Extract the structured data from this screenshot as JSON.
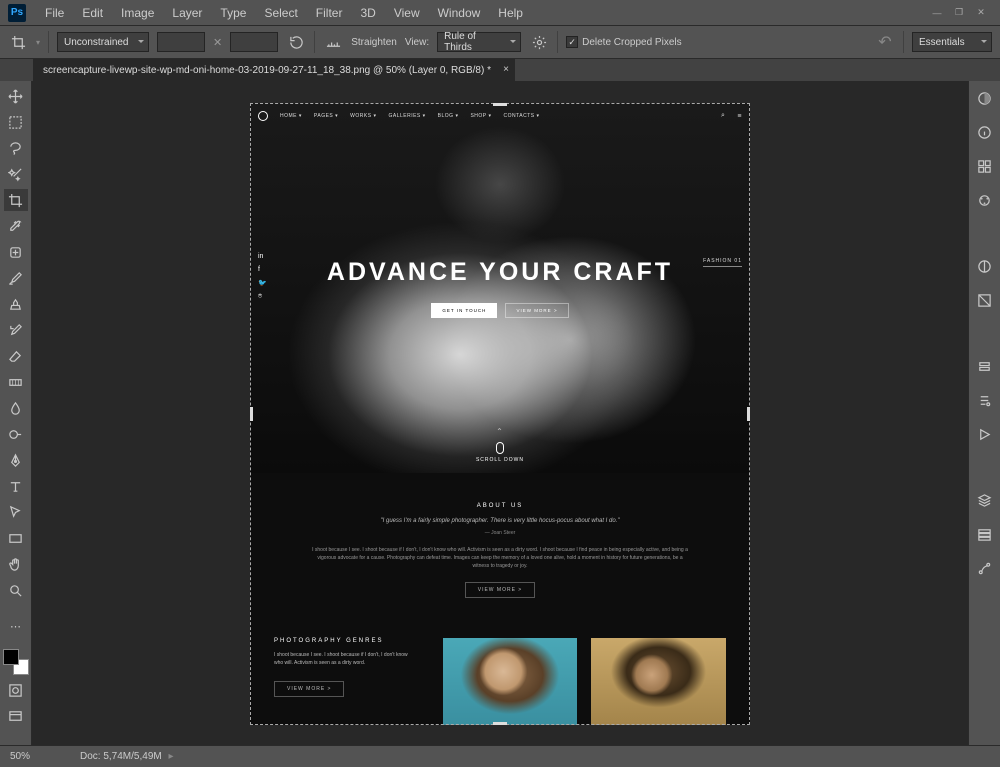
{
  "menubar": {
    "items": [
      "File",
      "Edit",
      "Image",
      "Layer",
      "Type",
      "Select",
      "Filter",
      "3D",
      "View",
      "Window",
      "Help"
    ]
  },
  "options": {
    "ratio": "Unconstrained",
    "width": "",
    "height": "",
    "straighten": "Straighten",
    "view_label": "View:",
    "view_value": "Rule of Thirds",
    "delete_cropped": "Delete Cropped Pixels",
    "workspace": "Essentials"
  },
  "tab": {
    "title": "screencapture-livewp-site-wp-md-oni-home-03-2019-09-27-11_18_38.png @ 50% (Layer 0, RGB/8) *"
  },
  "site": {
    "nav": [
      "HOME ▾",
      "PAGES ▾",
      "WORKS ▾",
      "GALLERIES ▾",
      "BLOG ▾",
      "SHOP ▾",
      "CONTACTS ▾"
    ],
    "hero_title": "ADVANCE YOUR CRAFT",
    "btn1": "GET IN TOUCH",
    "btn2": "VIEW MORE >",
    "meta": "FASHION   01",
    "scroll": "SCROLL DOWN",
    "about_h": "ABOUT US",
    "about_q": "\"I guess I'm a fairly simple photographer. There is very little hocus-pocus about what I do.\"",
    "about_a": "— Joan Steer",
    "about_p": "I shoot because I see. I shoot because if I don't, I don't know who will. Activism is seen as a dirty word. I shoot because I find peace in being especially active, and being a vigorous advocate for a cause. Photography can defeat time. Images can keep the memory of a loved one alive, hold a moment in history for future generations, be a witness to tragedy or joy.",
    "about_btn": "VIEW MORE  >",
    "genres_h": "PHOTOGRAPHY GENRES",
    "genres_p": "I shoot because I see. I shoot because if I don't, I don't know who will. Activism is seen as a dirty word.",
    "genres_btn": "VIEW MORE  >"
  },
  "status": {
    "zoom": "50%",
    "doc": "Doc: 5,74M/5,49M"
  }
}
